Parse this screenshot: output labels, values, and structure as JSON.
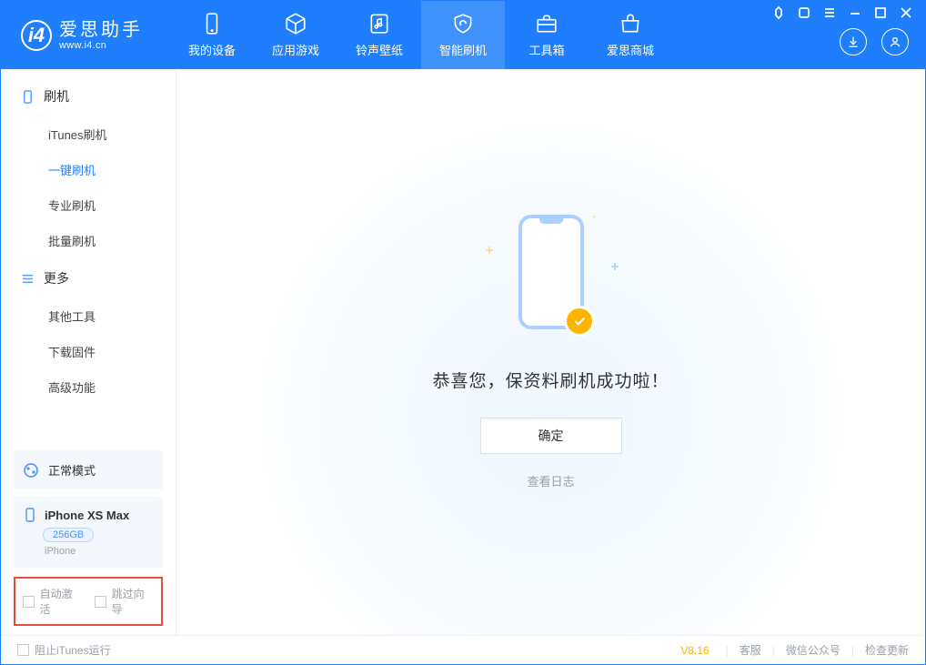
{
  "brand": {
    "name": "爱思助手",
    "url": "www.i4.cn"
  },
  "nav": {
    "tabs": [
      {
        "label": "我的设备"
      },
      {
        "label": "应用游戏"
      },
      {
        "label": "铃声壁纸"
      },
      {
        "label": "智能刷机"
      },
      {
        "label": "工具箱"
      },
      {
        "label": "爱思商城"
      }
    ]
  },
  "sidebar": {
    "group_flash": "刷机",
    "flash_items": [
      {
        "label": "iTunes刷机"
      },
      {
        "label": "一键刷机"
      },
      {
        "label": "专业刷机"
      },
      {
        "label": "批量刷机"
      }
    ],
    "group_more": "更多",
    "more_items": [
      {
        "label": "其他工具"
      },
      {
        "label": "下载固件"
      },
      {
        "label": "高级功能"
      }
    ],
    "mode_label": "正常模式",
    "device": {
      "name": "iPhone XS Max",
      "capacity": "256GB",
      "type": "iPhone"
    },
    "opts": {
      "auto_activate": "自动激活",
      "skip_guide": "跳过向导"
    }
  },
  "main": {
    "success_text": "恭喜您，保资料刷机成功啦！",
    "ok_button": "确定",
    "view_log": "查看日志"
  },
  "footer": {
    "block_itunes": "阻止iTunes运行",
    "version": "V8.16",
    "links": [
      "客服",
      "微信公众号",
      "检查更新"
    ]
  }
}
